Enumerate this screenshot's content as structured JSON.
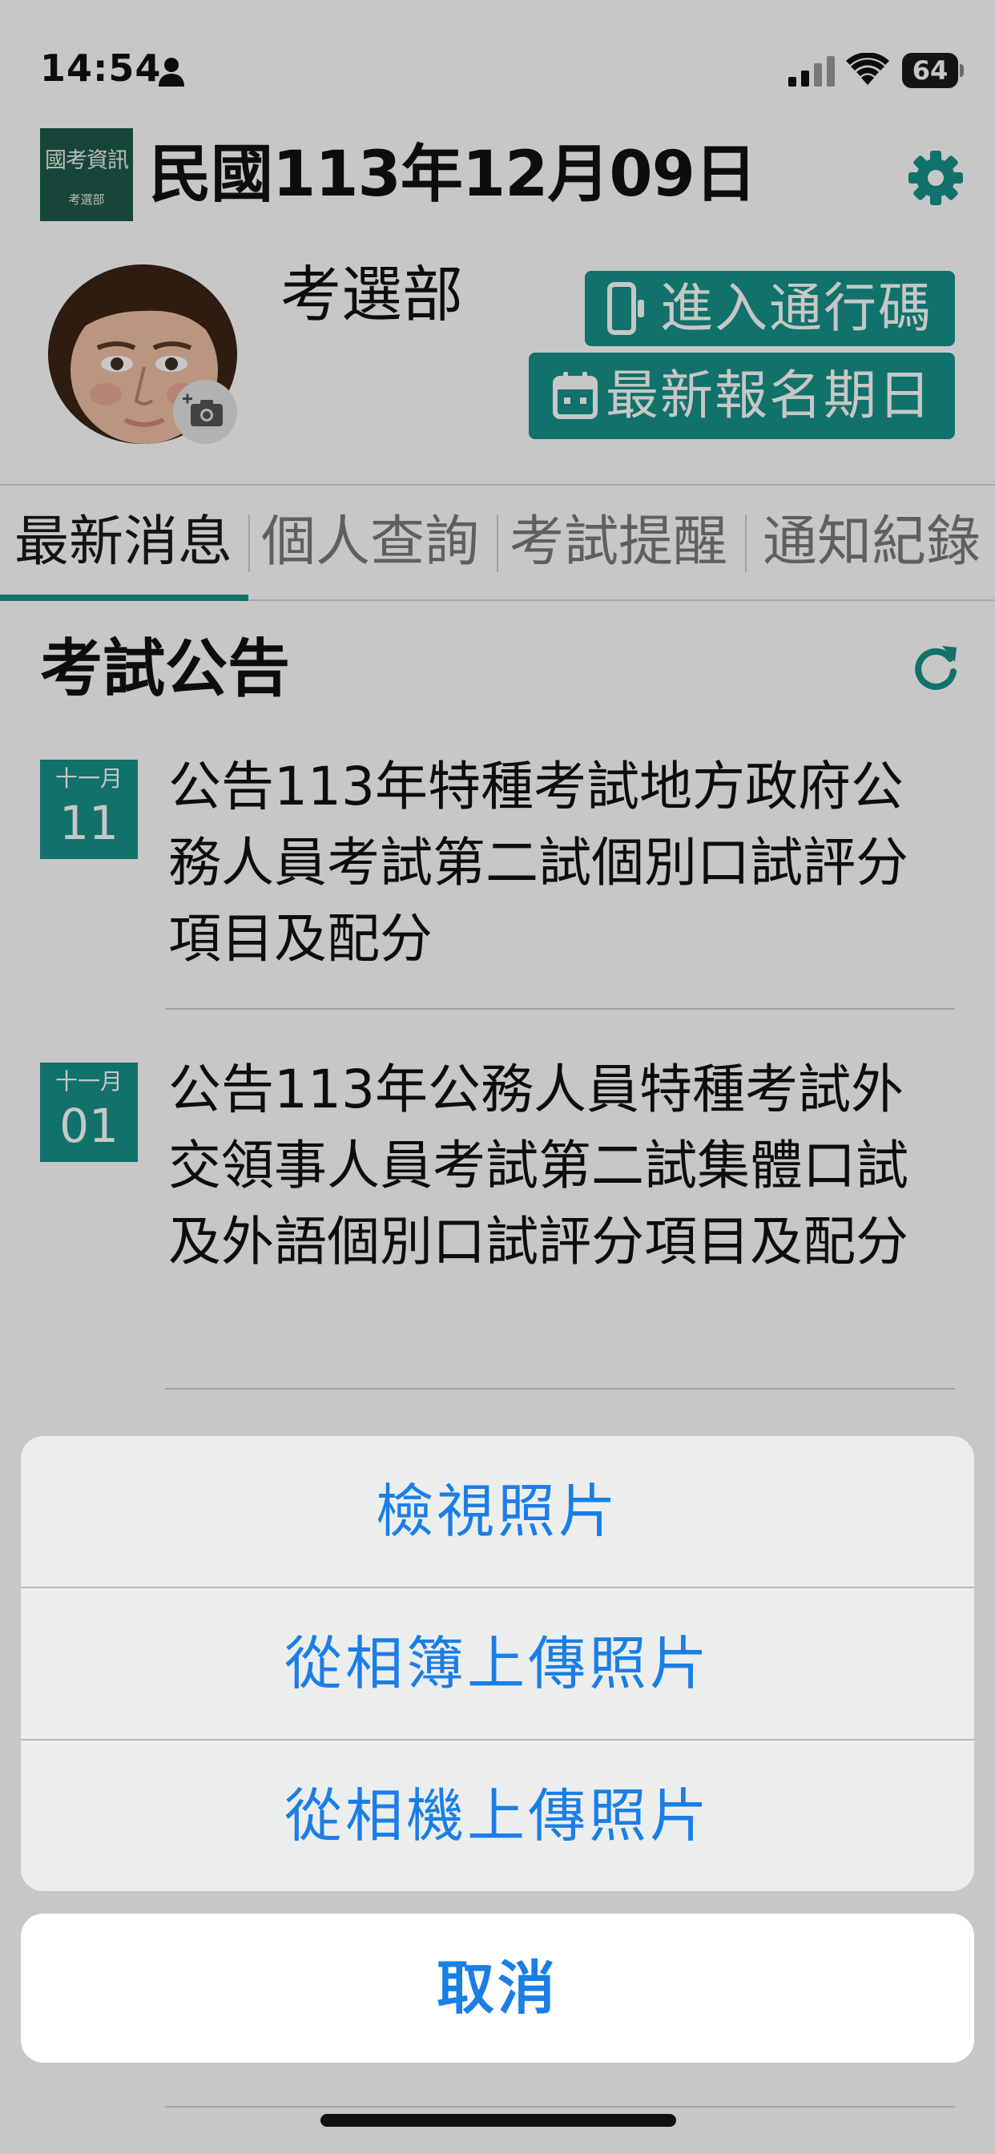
{
  "status_bar": {
    "time": "14:54",
    "battery": "64"
  },
  "header": {
    "logo_main": "國考資訊",
    "logo_sub": "考選部",
    "date": "民國113年12月09日"
  },
  "profile": {
    "name": "考選部",
    "pass_button": "進入通行碼",
    "signup_button": "最新報名期日"
  },
  "tabs": [
    {
      "label": "最新消息",
      "active": true
    },
    {
      "label": "個人查詢",
      "active": false
    },
    {
      "label": "考試提醒",
      "active": false
    },
    {
      "label": "通知紀錄",
      "active": false
    }
  ],
  "news": {
    "section_title": "考試公告",
    "items": [
      {
        "month": "十一月",
        "day": "11",
        "title": "公告113年特種考試地方政府公務人員考試第二試個別口試評分項目及配分"
      },
      {
        "month": "十一月",
        "day": "01",
        "title": "公告113年公務人員特種考試外交領事人員考試第二試集體口試及外語個別口試評分項目及配分"
      }
    ]
  },
  "action_sheet": {
    "options": [
      "檢視照片",
      "從相簿上傳照片",
      "從相機上傳照片"
    ],
    "cancel": "取消"
  },
  "colors": {
    "accent": "#17918a",
    "action_blue": "#1a7ee6"
  }
}
